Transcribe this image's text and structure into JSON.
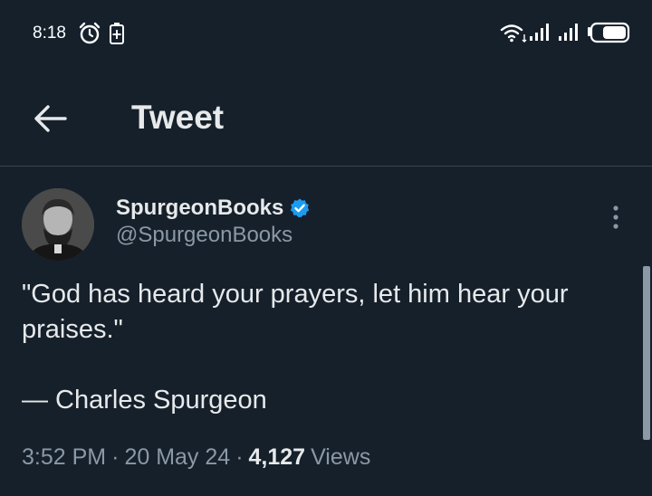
{
  "status_bar": {
    "time": "8:18",
    "icons": [
      "alarm-icon",
      "battery-saver-icon",
      "wifi-icon",
      "signal-icon",
      "signal-icon",
      "battery-icon"
    ]
  },
  "header": {
    "title": "Tweet",
    "back_icon": "arrow-left-icon"
  },
  "tweet": {
    "author": {
      "display_name": "SpurgeonBooks",
      "handle": "@SpurgeonBooks",
      "verified": true
    },
    "text": "\"God has heard your prayers, let him hear your praises.\"",
    "attribution": "— Charles Spurgeon",
    "time": "3:52 PM",
    "separator": "·",
    "date": "20 May 24",
    "views_count": "4,127",
    "views_label": "Views"
  },
  "colors": {
    "background": "#15202b",
    "text_primary": "#e7e9ea",
    "text_secondary": "#8b98a5",
    "verified_blue": "#1d9bf0",
    "divider": "#38444d"
  }
}
